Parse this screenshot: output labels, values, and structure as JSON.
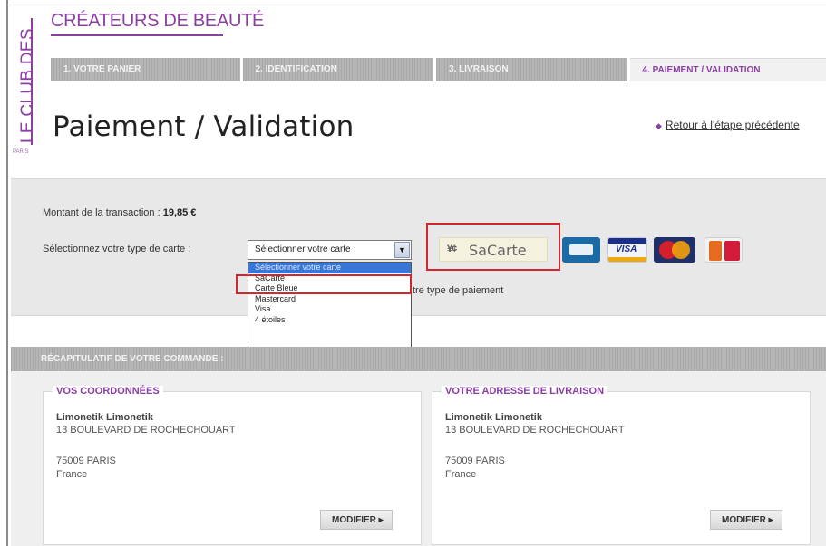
{
  "brand": {
    "vertical": "LE CLUB DES",
    "top": "CRÉATEURS DE BEAUTÉ",
    "city": "PARIS"
  },
  "steps": [
    {
      "label": "1. VOTRE PANIER"
    },
    {
      "label": "2. IDENTIFICATION"
    },
    {
      "label": "3. LIVRAISON"
    },
    {
      "label": "4. PAIEMENT / VALIDATION"
    }
  ],
  "header": {
    "title": "Paiement / Validation",
    "back_link": "Retour à l'étape précédente"
  },
  "payment": {
    "amount_label": "Montant de la transaction :",
    "amount_value": "19,85 €",
    "card_type_label": "Sélectionnez votre type de carte :",
    "select_value": "Sélectionner votre carte",
    "options": [
      "Sélectionner votre carte",
      "SaCarte",
      "Carte Bleue",
      "Mastercard",
      "Visa",
      "4 étoiles"
    ],
    "selected_option_index": 0,
    "hint_partial": "tre type de paiement",
    "sacarte_logo": "SaCarte",
    "sacarte_icon": "¥¢",
    "visa_text": "VISA",
    "highlight_color": "#d3262f"
  },
  "recap": {
    "title": "RÉCAPITULATIF DE VOTRE COMMANDE :",
    "billing": {
      "legend": "VOS COORDONNÉES",
      "name": "Limonetik Limonetik",
      "street": "13 BOULEVARD DE ROCHECHOUART",
      "city": "75009 PARIS",
      "country": "France",
      "button": "MODIFIER ▸"
    },
    "shipping": {
      "legend": "VOTRE ADRESSE DE LIVRAISON",
      "name": "Limonetik Limonetik",
      "street": "13 BOULEVARD DE ROCHECHOUART",
      "city": "75009 PARIS",
      "country": "France",
      "button": "MODIFIER ▸"
    }
  },
  "colors": {
    "brand": "#8b3fa3",
    "panel": "#e8e8e8",
    "selected": "#3876d8"
  }
}
